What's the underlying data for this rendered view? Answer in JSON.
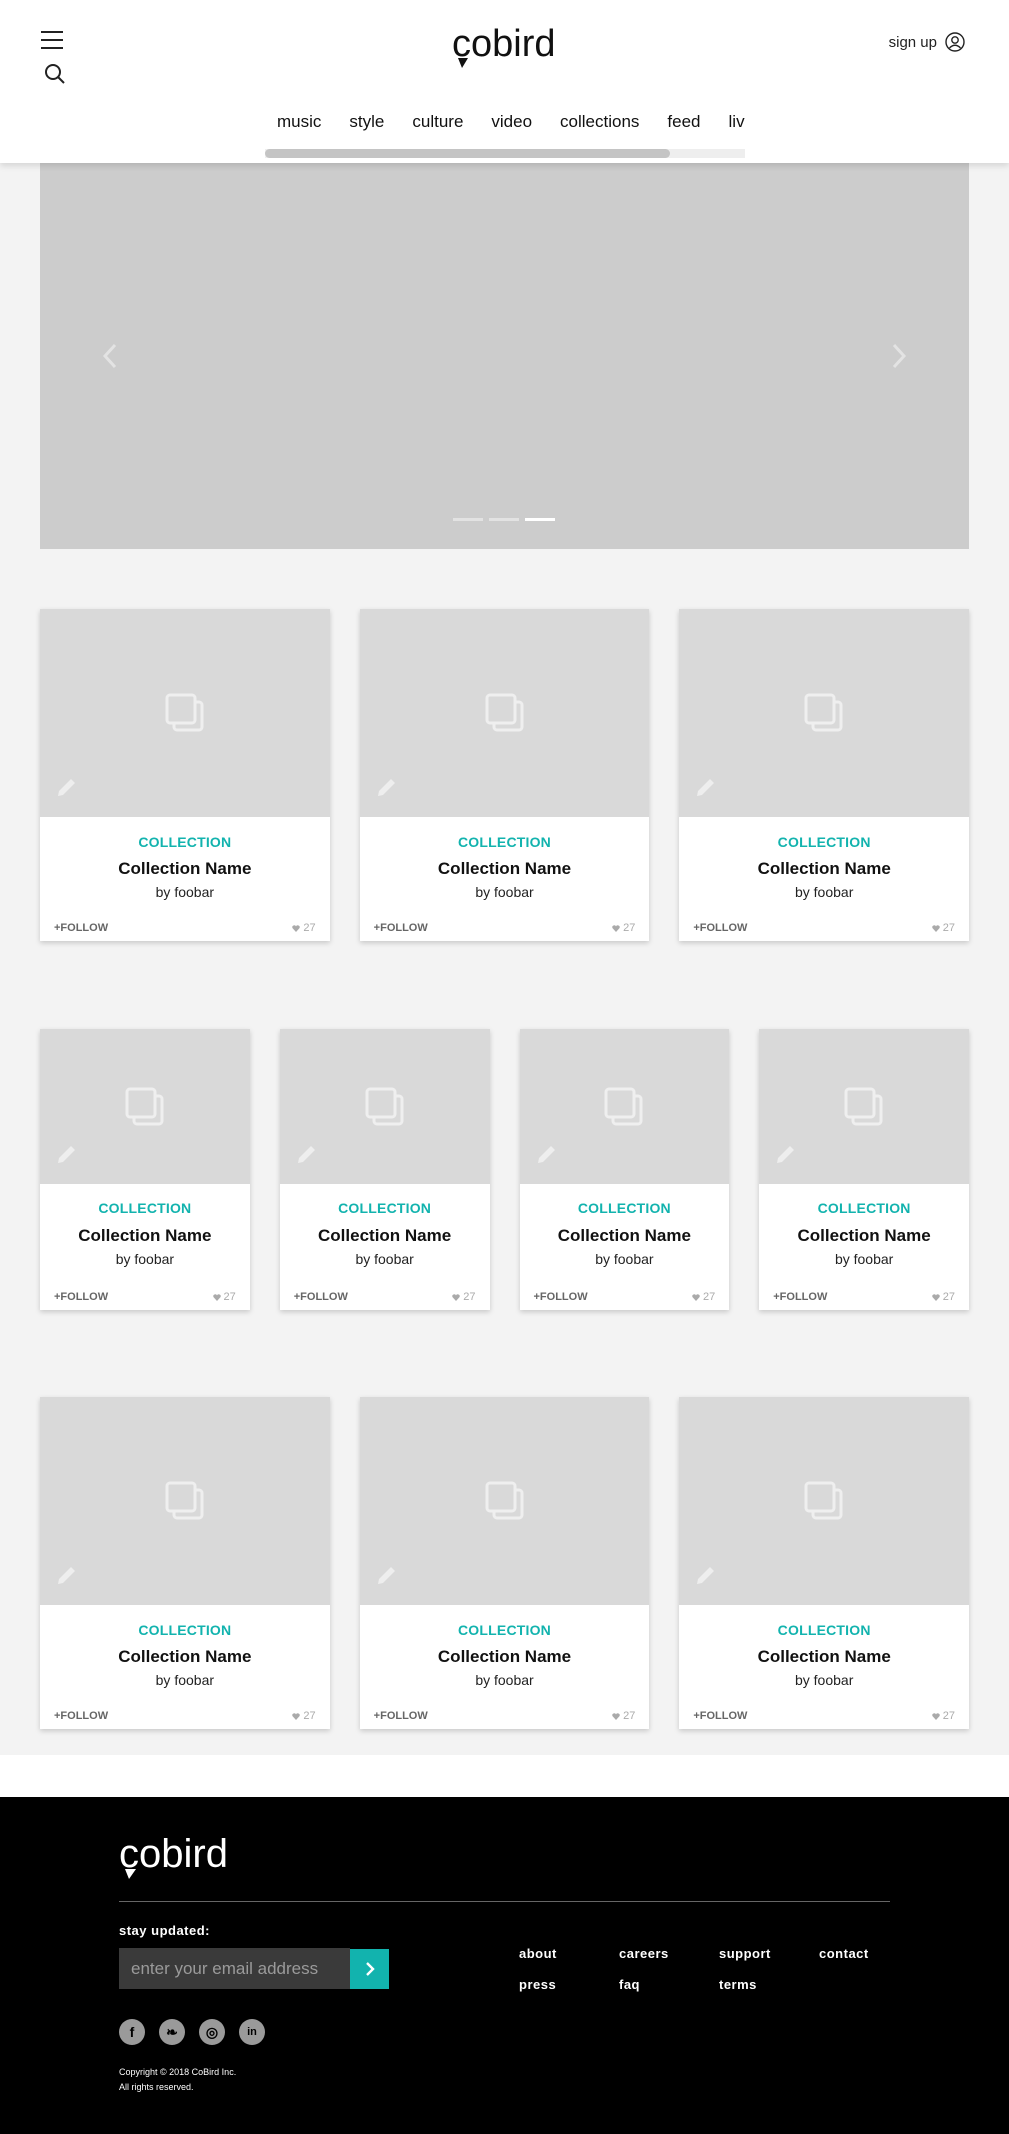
{
  "header": {
    "logo_text": "cobird",
    "signup_label": "sign up",
    "nav": [
      "music",
      "style",
      "culture",
      "video",
      "collections",
      "feed",
      "live"
    ]
  },
  "hero": {
    "slide_count": 3,
    "active_slide": 3
  },
  "sections": [
    {
      "cards": [
        {
          "kicker": "COLLECTION",
          "name": "Collection Name",
          "by": "by foobar",
          "follow": "+FOLLOW",
          "likes": "27"
        },
        {
          "kicker": "COLLECTION",
          "name": "Collection Name",
          "by": "by foobar",
          "follow": "+FOLLOW",
          "likes": "27"
        },
        {
          "kicker": "COLLECTION",
          "name": "Collection Name",
          "by": "by foobar",
          "follow": "+FOLLOW",
          "likes": "27"
        }
      ]
    },
    {
      "cards": [
        {
          "kicker": "COLLECTION",
          "name": "Collection Name",
          "by": "by foobar",
          "follow": "+FOLLOW",
          "likes": "27"
        },
        {
          "kicker": "COLLECTION",
          "name": "Collection Name",
          "by": "by foobar",
          "follow": "+FOLLOW",
          "likes": "27"
        },
        {
          "kicker": "COLLECTION",
          "name": "Collection Name",
          "by": "by foobar",
          "follow": "+FOLLOW",
          "likes": "27"
        },
        {
          "kicker": "COLLECTION",
          "name": "Collection Name",
          "by": "by foobar",
          "follow": "+FOLLOW",
          "likes": "27"
        }
      ]
    },
    {
      "cards": [
        {
          "kicker": "COLLECTION",
          "name": "Collection Name",
          "by": "by foobar",
          "follow": "+FOLLOW",
          "likes": "27"
        },
        {
          "kicker": "COLLECTION",
          "name": "Collection Name",
          "by": "by foobar",
          "follow": "+FOLLOW",
          "likes": "27"
        },
        {
          "kicker": "COLLECTION",
          "name": "Collection Name",
          "by": "by foobar",
          "follow": "+FOLLOW",
          "likes": "27"
        }
      ]
    }
  ],
  "footer": {
    "logo_text": "cobird",
    "stay_updated": "stay updated:",
    "email_placeholder": "enter your email address",
    "links": [
      "about",
      "careers",
      "support",
      "contact",
      "press",
      "faq",
      "terms"
    ],
    "socials": [
      "facebook-icon",
      "twitter-icon",
      "instagram-icon",
      "linkedin-icon"
    ],
    "copyright_line1": "Copyright © 2018 CoBird Inc.",
    "copyright_line2": "All rights reserved."
  },
  "colors": {
    "accent": "#12b3ae",
    "hero_bg": "#cccccc",
    "page_bg": "#f3f3f3",
    "footer_bg": "#000000"
  }
}
